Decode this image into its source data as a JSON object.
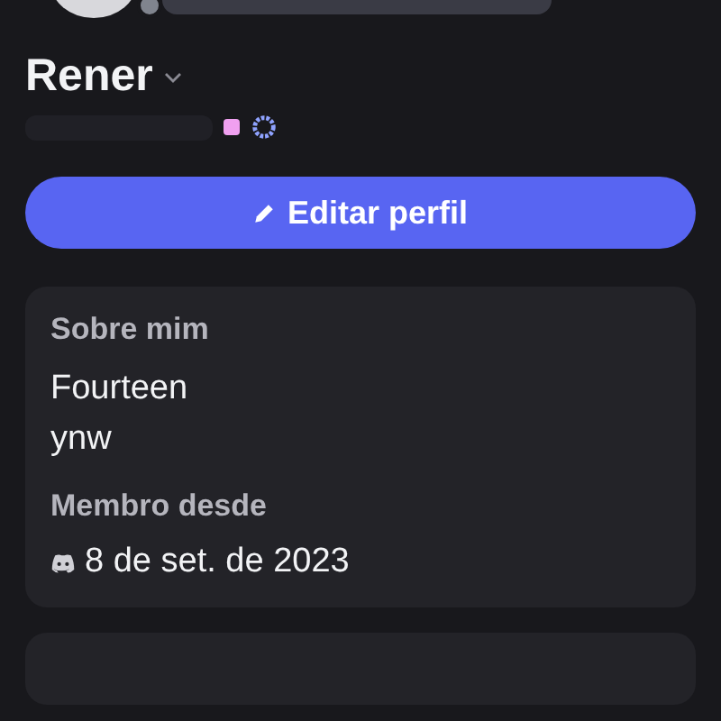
{
  "profile": {
    "display_name": "Rener"
  },
  "edit_button": {
    "label": "Editar perfil"
  },
  "about": {
    "title": "Sobre mim",
    "lines": [
      "Fourteen",
      "ynw"
    ]
  },
  "member_since": {
    "title": "Membro desde",
    "date": "8 de set. de 2023"
  }
}
